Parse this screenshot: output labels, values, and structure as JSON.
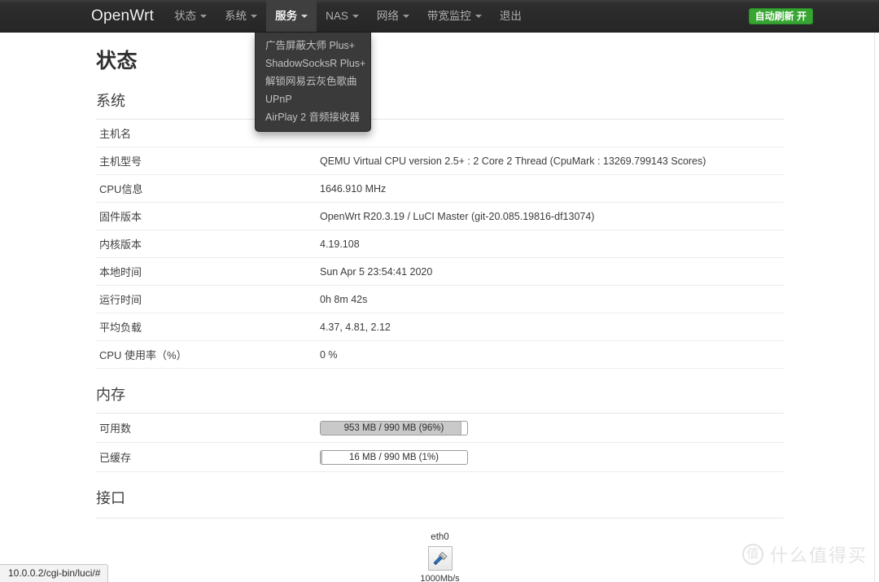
{
  "navbar": {
    "brand": "OpenWrt",
    "items": [
      {
        "label": "状态",
        "has_caret": true,
        "active": false
      },
      {
        "label": "系统",
        "has_caret": true,
        "active": false
      },
      {
        "label": "服务",
        "has_caret": true,
        "active": true
      },
      {
        "label": "NAS",
        "has_caret": true,
        "active": false
      },
      {
        "label": "网络",
        "has_caret": true,
        "active": false
      },
      {
        "label": "带宽监控",
        "has_caret": true,
        "active": false
      },
      {
        "label": "退出",
        "has_caret": false,
        "active": false
      }
    ],
    "refresh_badge": "自动刷新 开",
    "accent_color": "#37a532",
    "bar_color": "#2d2d2d"
  },
  "dropdown": {
    "owner": "服务",
    "items": [
      "广告屏蔽大师 Plus+",
      "ShadowSocksR Plus+",
      "解锁网易云灰色歌曲",
      "UPnP",
      "AirPlay 2 音频接收器"
    ]
  },
  "main": {
    "page_title": "状态",
    "system": {
      "heading": "系统",
      "rows": [
        {
          "key": "主机名",
          "value": ""
        },
        {
          "key": "主机型号",
          "value": "QEMU Virtual CPU version 2.5+ : 2 Core 2 Thread (CpuMark : 13269.799143 Scores)"
        },
        {
          "key": "CPU信息",
          "value": "1646.910 MHz"
        },
        {
          "key": "固件版本",
          "value": "OpenWrt R20.3.19 / LuCI Master (git-20.085.19816-df13074)"
        },
        {
          "key": "内核版本",
          "value": "4.19.108"
        },
        {
          "key": "本地时间",
          "value": "Sun Apr 5 23:54:41 2020"
        },
        {
          "key": "运行时间",
          "value": "0h 8m 42s"
        },
        {
          "key": "平均负载",
          "value": "4.37, 4.81, 2.12"
        },
        {
          "key": "CPU 使用率（%）",
          "value": "0 %"
        }
      ]
    },
    "memory": {
      "heading": "内存",
      "rows": [
        {
          "key": "可用数",
          "text": "953 MB / 990 MB (96%)",
          "percent": 96
        },
        {
          "key": "已缓存",
          "text": "16 MB / 990 MB (1%)",
          "percent": 1
        }
      ]
    },
    "interfaces": {
      "heading": "接口",
      "items": [
        {
          "name": "eth0",
          "speed": "1000Mb/s",
          "icon": "ethernet-icon"
        }
      ]
    }
  },
  "statusbar": {
    "url": "10.0.0.2/cgi-bin/luci/#"
  },
  "watermark": {
    "badge": "值",
    "text": "什么值得买"
  }
}
